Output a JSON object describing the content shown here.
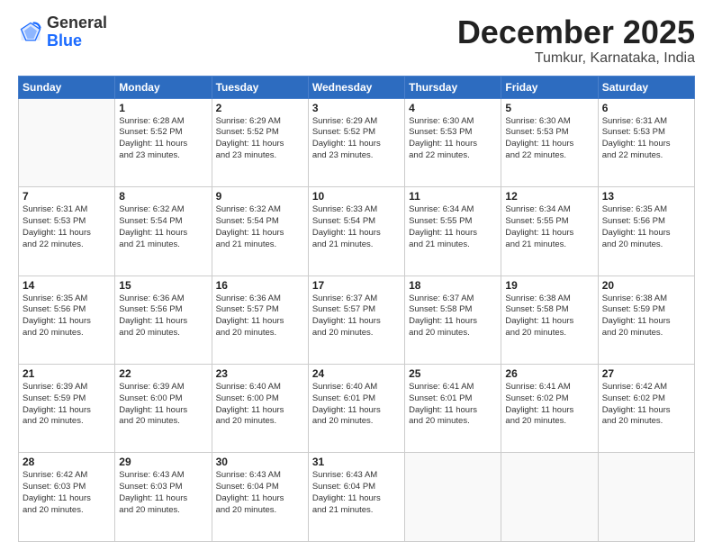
{
  "header": {
    "logo_general": "General",
    "logo_blue": "Blue",
    "title": "December 2025",
    "subtitle": "Tumkur, Karnataka, India"
  },
  "weekdays": [
    "Sunday",
    "Monday",
    "Tuesday",
    "Wednesday",
    "Thursday",
    "Friday",
    "Saturday"
  ],
  "weeks": [
    [
      {
        "day": "",
        "info": ""
      },
      {
        "day": "1",
        "info": "Sunrise: 6:28 AM\nSunset: 5:52 PM\nDaylight: 11 hours\nand 23 minutes."
      },
      {
        "day": "2",
        "info": "Sunrise: 6:29 AM\nSunset: 5:52 PM\nDaylight: 11 hours\nand 23 minutes."
      },
      {
        "day": "3",
        "info": "Sunrise: 6:29 AM\nSunset: 5:52 PM\nDaylight: 11 hours\nand 23 minutes."
      },
      {
        "day": "4",
        "info": "Sunrise: 6:30 AM\nSunset: 5:53 PM\nDaylight: 11 hours\nand 22 minutes."
      },
      {
        "day": "5",
        "info": "Sunrise: 6:30 AM\nSunset: 5:53 PM\nDaylight: 11 hours\nand 22 minutes."
      },
      {
        "day": "6",
        "info": "Sunrise: 6:31 AM\nSunset: 5:53 PM\nDaylight: 11 hours\nand 22 minutes."
      }
    ],
    [
      {
        "day": "7",
        "info": "Sunrise: 6:31 AM\nSunset: 5:53 PM\nDaylight: 11 hours\nand 22 minutes."
      },
      {
        "day": "8",
        "info": "Sunrise: 6:32 AM\nSunset: 5:54 PM\nDaylight: 11 hours\nand 21 minutes."
      },
      {
        "day": "9",
        "info": "Sunrise: 6:32 AM\nSunset: 5:54 PM\nDaylight: 11 hours\nand 21 minutes."
      },
      {
        "day": "10",
        "info": "Sunrise: 6:33 AM\nSunset: 5:54 PM\nDaylight: 11 hours\nand 21 minutes."
      },
      {
        "day": "11",
        "info": "Sunrise: 6:34 AM\nSunset: 5:55 PM\nDaylight: 11 hours\nand 21 minutes."
      },
      {
        "day": "12",
        "info": "Sunrise: 6:34 AM\nSunset: 5:55 PM\nDaylight: 11 hours\nand 21 minutes."
      },
      {
        "day": "13",
        "info": "Sunrise: 6:35 AM\nSunset: 5:56 PM\nDaylight: 11 hours\nand 20 minutes."
      }
    ],
    [
      {
        "day": "14",
        "info": "Sunrise: 6:35 AM\nSunset: 5:56 PM\nDaylight: 11 hours\nand 20 minutes."
      },
      {
        "day": "15",
        "info": "Sunrise: 6:36 AM\nSunset: 5:56 PM\nDaylight: 11 hours\nand 20 minutes."
      },
      {
        "day": "16",
        "info": "Sunrise: 6:36 AM\nSunset: 5:57 PM\nDaylight: 11 hours\nand 20 minutes."
      },
      {
        "day": "17",
        "info": "Sunrise: 6:37 AM\nSunset: 5:57 PM\nDaylight: 11 hours\nand 20 minutes."
      },
      {
        "day": "18",
        "info": "Sunrise: 6:37 AM\nSunset: 5:58 PM\nDaylight: 11 hours\nand 20 minutes."
      },
      {
        "day": "19",
        "info": "Sunrise: 6:38 AM\nSunset: 5:58 PM\nDaylight: 11 hours\nand 20 minutes."
      },
      {
        "day": "20",
        "info": "Sunrise: 6:38 AM\nSunset: 5:59 PM\nDaylight: 11 hours\nand 20 minutes."
      }
    ],
    [
      {
        "day": "21",
        "info": "Sunrise: 6:39 AM\nSunset: 5:59 PM\nDaylight: 11 hours\nand 20 minutes."
      },
      {
        "day": "22",
        "info": "Sunrise: 6:39 AM\nSunset: 6:00 PM\nDaylight: 11 hours\nand 20 minutes."
      },
      {
        "day": "23",
        "info": "Sunrise: 6:40 AM\nSunset: 6:00 PM\nDaylight: 11 hours\nand 20 minutes."
      },
      {
        "day": "24",
        "info": "Sunrise: 6:40 AM\nSunset: 6:01 PM\nDaylight: 11 hours\nand 20 minutes."
      },
      {
        "day": "25",
        "info": "Sunrise: 6:41 AM\nSunset: 6:01 PM\nDaylight: 11 hours\nand 20 minutes."
      },
      {
        "day": "26",
        "info": "Sunrise: 6:41 AM\nSunset: 6:02 PM\nDaylight: 11 hours\nand 20 minutes."
      },
      {
        "day": "27",
        "info": "Sunrise: 6:42 AM\nSunset: 6:02 PM\nDaylight: 11 hours\nand 20 minutes."
      }
    ],
    [
      {
        "day": "28",
        "info": "Sunrise: 6:42 AM\nSunset: 6:03 PM\nDaylight: 11 hours\nand 20 minutes."
      },
      {
        "day": "29",
        "info": "Sunrise: 6:43 AM\nSunset: 6:03 PM\nDaylight: 11 hours\nand 20 minutes."
      },
      {
        "day": "30",
        "info": "Sunrise: 6:43 AM\nSunset: 6:04 PM\nDaylight: 11 hours\nand 20 minutes."
      },
      {
        "day": "31",
        "info": "Sunrise: 6:43 AM\nSunset: 6:04 PM\nDaylight: 11 hours\nand 21 minutes."
      },
      {
        "day": "",
        "info": ""
      },
      {
        "day": "",
        "info": ""
      },
      {
        "day": "",
        "info": ""
      }
    ]
  ]
}
